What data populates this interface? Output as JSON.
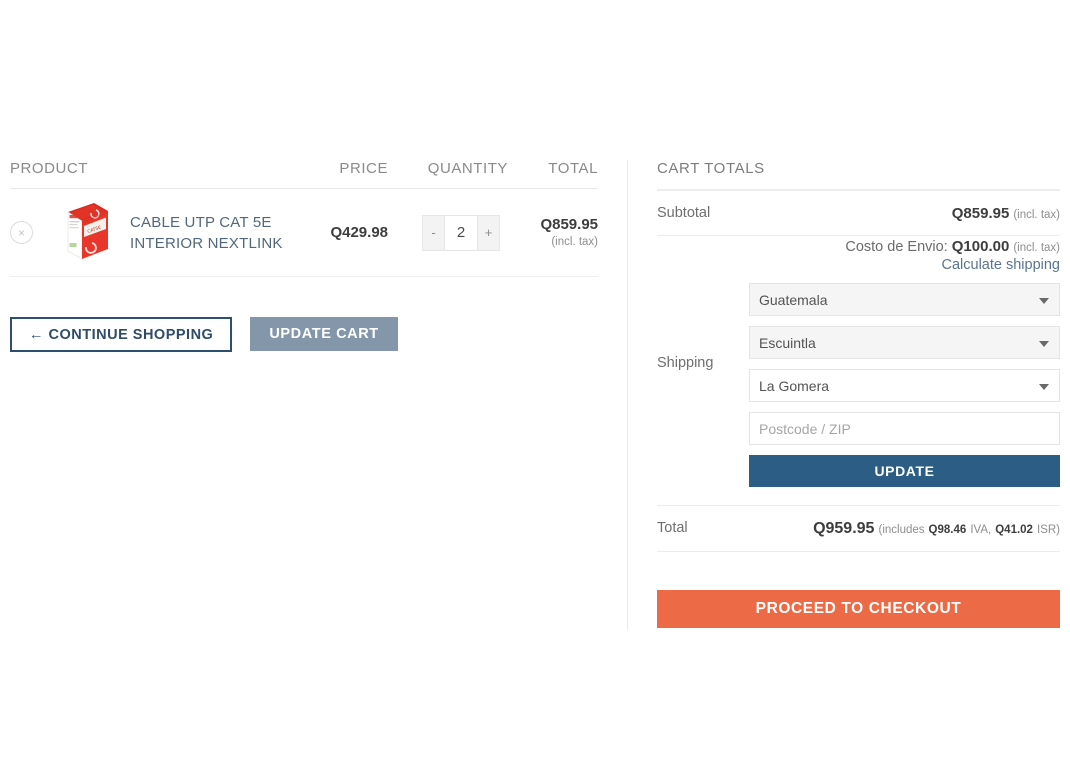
{
  "cart_table": {
    "columns": {
      "product": "PRODUCT",
      "price": "PRICE",
      "quantity": "QUANTITY",
      "total": "TOTAL"
    },
    "rows": [
      {
        "remove_label": "×",
        "thumbnail": "product-box-red-white",
        "name": "CABLE UTP CAT 5E INTERIOR NEXTLINK",
        "price": "Q429.98",
        "quantity": "2",
        "qty_decrease": "-",
        "qty_increase": "+",
        "total": "Q859.95",
        "total_note": "(incl. tax)"
      }
    ]
  },
  "actions": {
    "continue_shopping": "← CONTINUE SHOPPING",
    "update_cart": "UPDATE CART"
  },
  "totals": {
    "title": "CART TOTALS",
    "subtotal_label": "Subtotal",
    "subtotal_value": "Q859.95",
    "subtotal_note": "(incl. tax)",
    "shipping_label": "Shipping",
    "shipping_cost_label": "Costo de Envio:",
    "shipping_cost_value": "Q100.00",
    "shipping_cost_note": "(incl. tax)",
    "calculate_shipping": "Calculate shipping",
    "country": "Guatemala",
    "state": "Escuintla",
    "city": "La Gomera",
    "postcode_value": "",
    "postcode_placeholder": "Postcode / ZIP",
    "update_button": "UPDATE",
    "total_label": "Total",
    "total_value": "Q959.95",
    "total_includes_prefix": "(includes",
    "tax1_value": "Q98.46",
    "tax1_name": "IVA,",
    "tax2_value": "Q41.02",
    "tax2_name": "ISR)",
    "checkout_button": "PROCEED TO CHECKOUT"
  },
  "colors": {
    "accent_orange": "#ec6a45",
    "button_blue": "#2c5d85",
    "continue_border": "#2c4f70",
    "update_cart_gray": "#8496aa",
    "link_slate": "#5a7490",
    "product_link": "#53677c"
  }
}
